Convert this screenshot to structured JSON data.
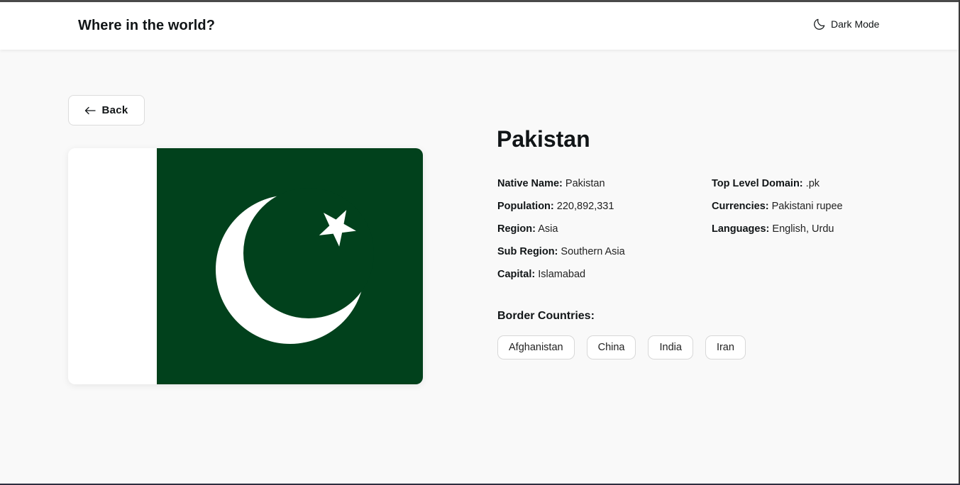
{
  "header": {
    "title": "Where in the world?",
    "mode_label": "Dark Mode",
    "mode_icon": "moon-icon"
  },
  "back_button": {
    "label": "Back",
    "icon": "arrow-left-icon"
  },
  "flag": {
    "colors": {
      "white": "#ffffff",
      "green": "#01411c"
    }
  },
  "country": {
    "name": "Pakistan",
    "details_left": [
      {
        "key": "Native Name:",
        "value": "Pakistan"
      },
      {
        "key": "Population:",
        "value": "220,892,331"
      },
      {
        "key": "Region:",
        "value": "Asia"
      },
      {
        "key": "Sub Region:",
        "value": "Southern Asia"
      },
      {
        "key": "Capital:",
        "value": "Islamabad"
      }
    ],
    "details_right": [
      {
        "key": "Top Level Domain:",
        "value": ".pk"
      },
      {
        "key": "Currencies:",
        "value": "Pakistani rupee"
      },
      {
        "key": "Languages:",
        "value": "English, Urdu"
      }
    ],
    "border_title": "Border Countries:",
    "borders": [
      "Afghanistan",
      "China",
      "India",
      "Iran"
    ]
  }
}
